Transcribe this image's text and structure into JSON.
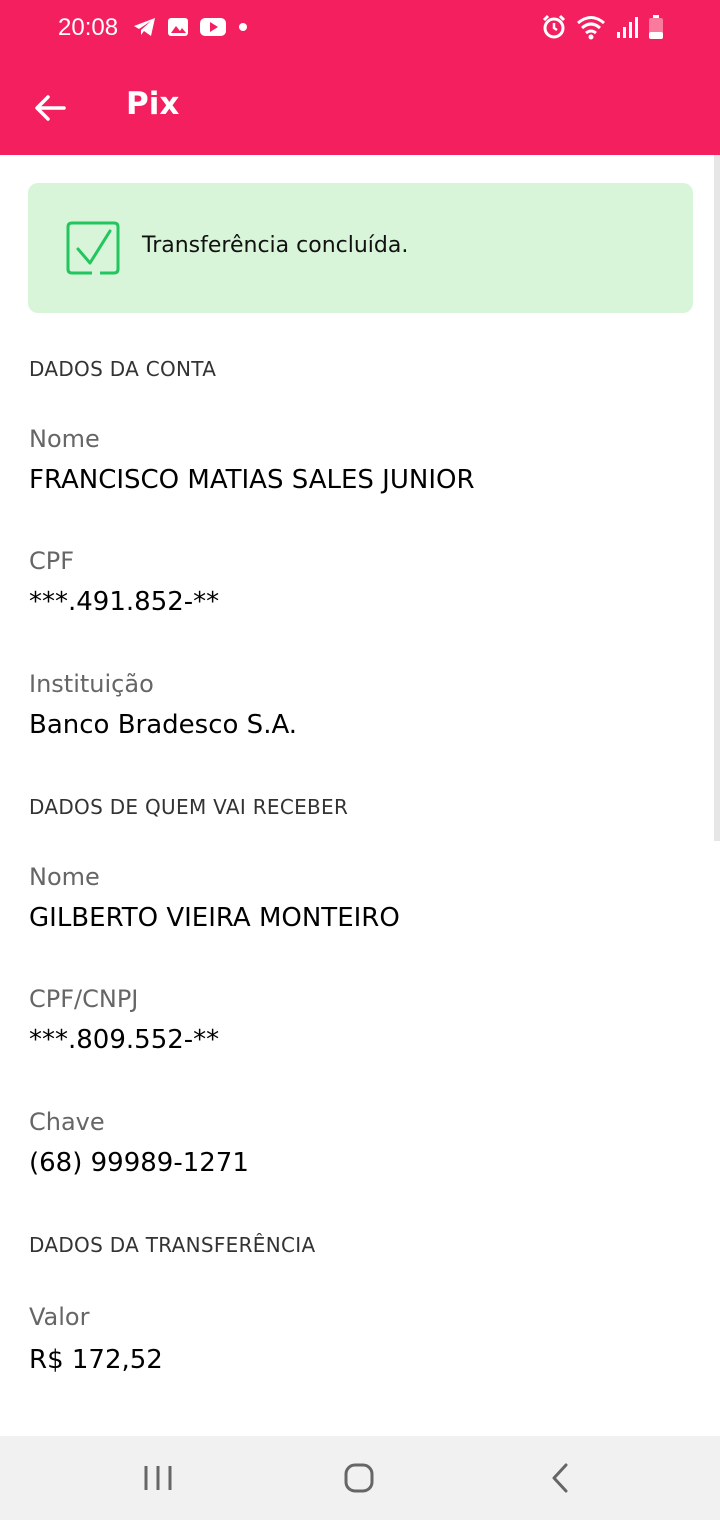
{
  "status_bar": {
    "time": "20:08",
    "left_icons": [
      "telegram-icon",
      "gallery-icon",
      "youtube-icon",
      "dot-icon"
    ],
    "right_icons": [
      "alarm-icon",
      "wifi-icon",
      "signal-icon",
      "battery-icon"
    ]
  },
  "app_bar": {
    "title": "Pix",
    "back_icon": "arrow-left-icon",
    "color": "#f41f5f"
  },
  "banner": {
    "text": "Transferência concluída.",
    "icon": "check-square-icon",
    "background": "#d8f5d9",
    "icon_color": "#22c55e"
  },
  "account_section": {
    "title": "DADOS DA CONTA",
    "name_label": "Nome",
    "name_value": "FRANCISCO MATIAS SALES JUNIOR",
    "cpf_label": "CPF",
    "cpf_value": "***.491.852-**",
    "institution_label": "Instituição",
    "institution_value": "Banco Bradesco S.A."
  },
  "recipient_section": {
    "title": "DADOS DE QUEM VAI RECEBER",
    "name_label": "Nome",
    "name_value": "GILBERTO VIEIRA MONTEIRO",
    "doc_label": "CPF/CNPJ",
    "doc_value": "***.809.552-**",
    "key_label": "Chave",
    "key_value": "(68) 99989-1271"
  },
  "transfer_section": {
    "title": "DADOS DA TRANSFERÊNCIA",
    "amount_label": "Valor",
    "amount_value": "R$ 172,52"
  },
  "nav_bar": {
    "icons": [
      "recent-apps-icon",
      "home-icon",
      "back-icon"
    ]
  }
}
